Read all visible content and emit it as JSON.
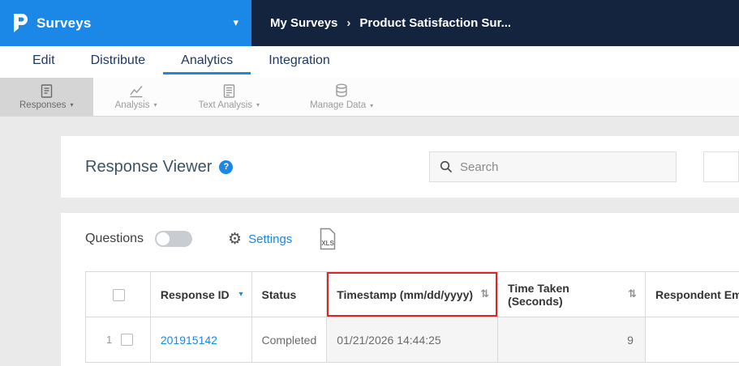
{
  "header": {
    "brand": "Surveys",
    "breadcrumb": {
      "parent": "My Surveys",
      "separator": "›",
      "current": "Product Satisfaction Sur..."
    }
  },
  "nav": {
    "tabs": [
      {
        "label": "Edit"
      },
      {
        "label": "Distribute"
      },
      {
        "label": "Analytics"
      },
      {
        "label": "Integration"
      }
    ]
  },
  "toolbar": {
    "items": [
      {
        "label": "Responses"
      },
      {
        "label": "Analysis"
      },
      {
        "label": "Text Analysis"
      },
      {
        "label": "Manage Data"
      }
    ]
  },
  "main": {
    "title": "Response Viewer",
    "help": "?",
    "search_placeholder": "Search",
    "questions_label": "Questions",
    "settings_label": "Settings",
    "xls_label": "XLS"
  },
  "table": {
    "columns": {
      "response_id": "Response ID",
      "status": "Status",
      "timestamp": "Timestamp (mm/dd/yyyy)",
      "time_taken": "Time Taken (Seconds)",
      "respondent_email": "Respondent Em"
    },
    "rows": [
      {
        "num": "1",
        "response_id": "201915142",
        "status": "Completed",
        "timestamp": "01/21/2026 14:44:25",
        "time_taken": "9",
        "respondent_email": ""
      }
    ]
  },
  "icons": {
    "dropdown_caret": "▾",
    "sort": "⇅",
    "gear": "⚙"
  },
  "colors": {
    "brand_blue": "#1B87E6",
    "header_dark": "#14243E",
    "highlight_red": "#E02424"
  }
}
